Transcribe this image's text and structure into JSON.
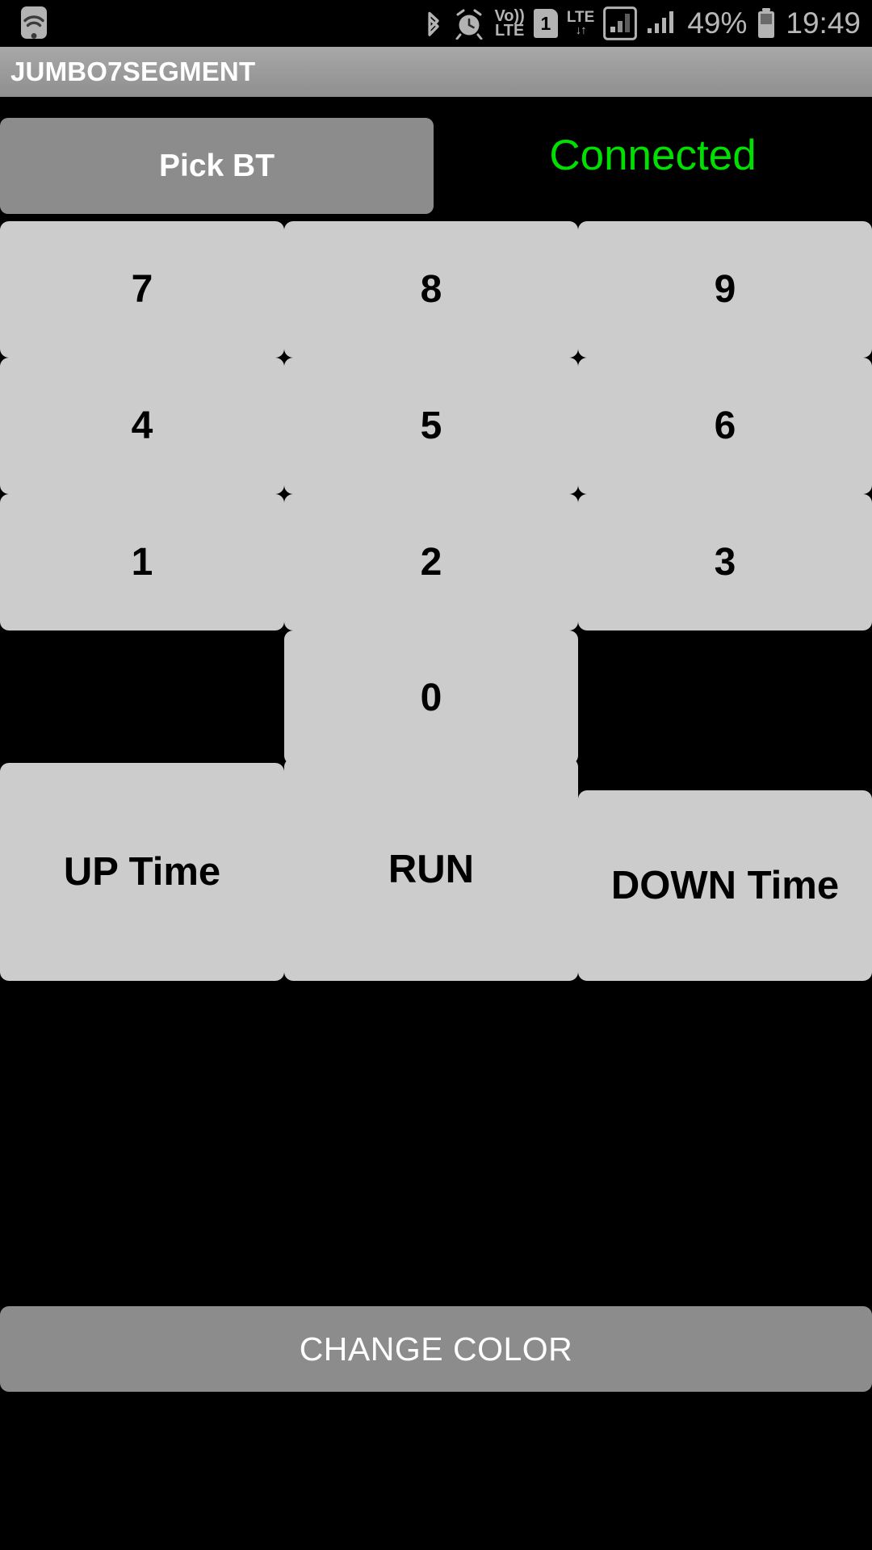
{
  "status_bar": {
    "wifi_icon": "wifi-icon",
    "bluetooth_icon": "bluetooth-icon",
    "alarm_icon": "alarm-clock-icon",
    "volte_line1": "Vo))",
    "volte_line2": "LTE",
    "sim_label": "1",
    "lte_label": "LTE",
    "lte_arrows": "↓↑",
    "signal_boxed_icon": "signal-bars-boxed-icon",
    "signal_icon": "signal-bars-icon",
    "battery_percent": "49%",
    "battery_icon": "battery-icon",
    "clock": "19:49"
  },
  "title_bar": {
    "title": "JUMBO7SEGMENT"
  },
  "top_row": {
    "pick_bt_label": "Pick BT",
    "connection_status": "Connected",
    "connection_color": "#00e000"
  },
  "keypad": {
    "rows": [
      [
        "7",
        "8",
        "9"
      ],
      [
        "4",
        "5",
        "6"
      ],
      [
        "1",
        "2",
        "3"
      ]
    ],
    "zero": "0"
  },
  "actions": {
    "up_time": "UP Time",
    "run": "RUN",
    "down_time": "DOWN Time"
  },
  "footer": {
    "change_color": "CHANGE COLOR"
  },
  "colors": {
    "background": "#000000",
    "key_face": "#cccccc",
    "gray_button": "#8c8c8c",
    "title_bar": "#9a9a9a",
    "status_green": "#00e000"
  }
}
